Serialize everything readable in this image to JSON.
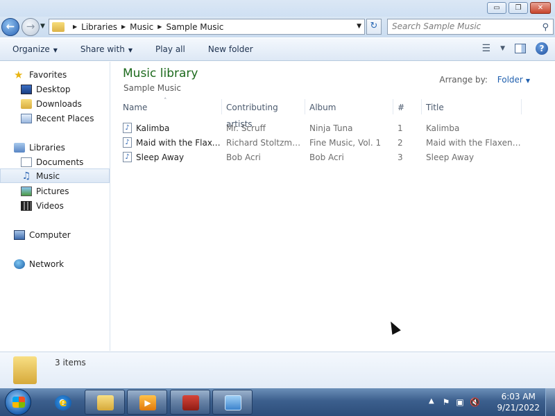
{
  "window": {
    "controls": {
      "minimize": "▭",
      "restore": "❐",
      "close": "✕"
    }
  },
  "address": {
    "crumbs": [
      "Libraries",
      "Music",
      "Sample Music"
    ],
    "search_placeholder": "Search Sample Music"
  },
  "toolbar": {
    "organize": "Organize",
    "share_with": "Share with",
    "play_all": "Play all",
    "new_folder": "New folder"
  },
  "nav": {
    "favorites": "Favorites",
    "desktop": "Desktop",
    "downloads": "Downloads",
    "recent_places": "Recent Places",
    "libraries": "Libraries",
    "documents": "Documents",
    "music": "Music",
    "pictures": "Pictures",
    "videos": "Videos",
    "computer": "Computer",
    "network": "Network"
  },
  "content": {
    "title": "Music library",
    "subtitle": "Sample Music",
    "arrange_label": "Arrange by:",
    "arrange_value": "Folder",
    "columns": [
      "Name",
      "Contributing artists",
      "Album",
      "#",
      "Title"
    ],
    "rows": [
      {
        "name": "Kalimba",
        "artist": "Mr. Scruff",
        "album": "Ninja Tuna",
        "track": "1",
        "title": "Kalimba"
      },
      {
        "name": "Maid with the Flaxen Hair",
        "artist": "Richard Stoltzman; Slovak Radio Symphony Orchestra",
        "album": "Fine Music, Vol. 1",
        "track": "2",
        "title": "Maid with the Flaxen Hair"
      },
      {
        "name": "Sleep Away",
        "artist": "Bob Acri",
        "album": "Bob Acri",
        "track": "3",
        "title": "Sleep Away"
      }
    ]
  },
  "details": {
    "count_text": "3 items"
  },
  "taskbar": {
    "time": "6:03 AM",
    "date": "9/21/2022"
  },
  "colors": {
    "library_title": "#1d6a1d",
    "arrange_link": "#1f5fae",
    "taskbar": "#3c5f8d"
  }
}
